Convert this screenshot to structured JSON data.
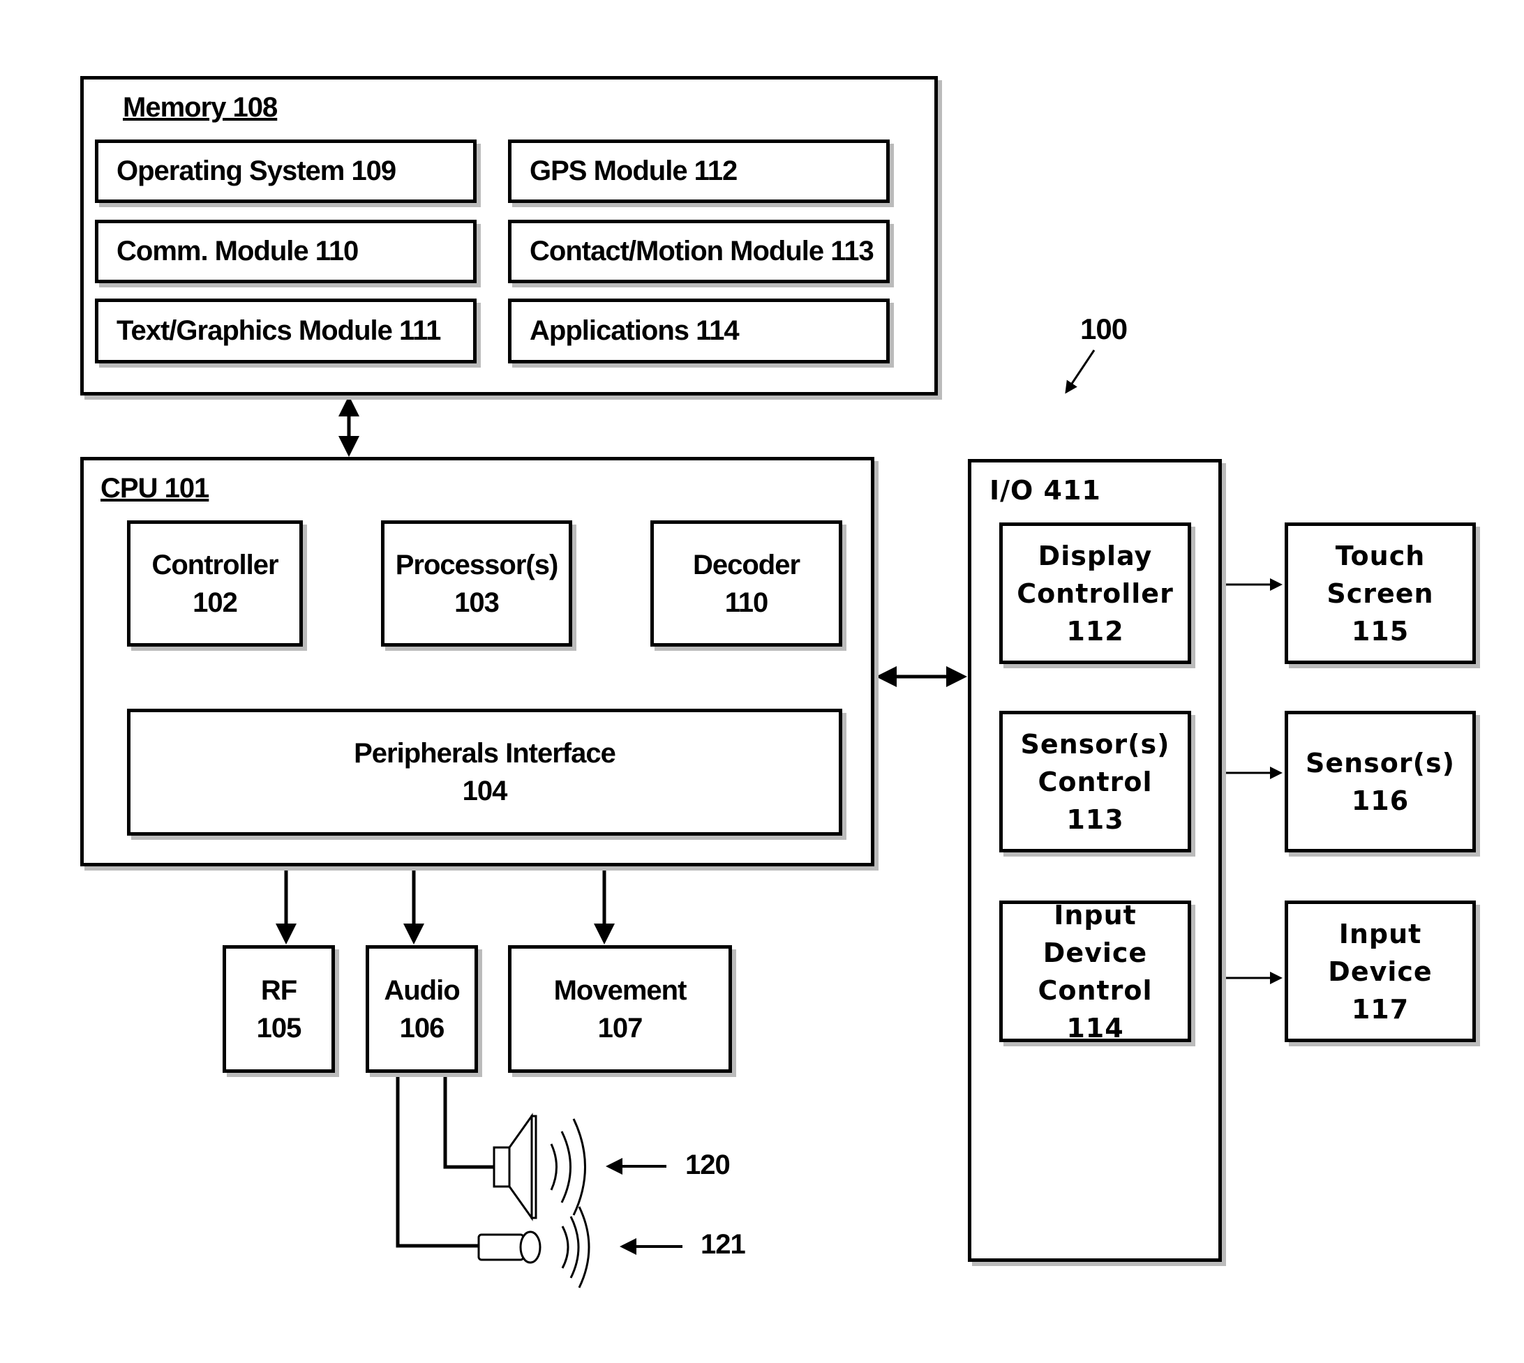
{
  "figure_ref": "100",
  "memory": {
    "title": "Memory 108",
    "modules": [
      "Operating System 109",
      "GPS Module 112",
      "Comm. Module 110",
      "Contact/Motion Module 113",
      "Text/Graphics Module 111",
      "Applications 114"
    ]
  },
  "cpu": {
    "title": "CPU 101",
    "controller": {
      "name": "Controller",
      "num": "102"
    },
    "processor": {
      "name": "Processor(s)",
      "num": "103"
    },
    "decoder": {
      "name": "Decoder",
      "num": "110"
    },
    "peripherals": {
      "name": "Peripherals Interface",
      "num": "104"
    }
  },
  "peripherals": {
    "rf": {
      "name": "RF",
      "num": "105"
    },
    "audio": {
      "name": "Audio",
      "num": "106"
    },
    "movement": {
      "name": "Movement",
      "num": "107"
    }
  },
  "audio_devices": {
    "speaker_ref": "120",
    "microphone_ref": "121"
  },
  "io": {
    "title": "I/O 411",
    "controllers": [
      {
        "line1": "Display",
        "line2": "Controller",
        "num": "112"
      },
      {
        "line1": "Sensor(s)",
        "line2": "Control",
        "num": "113"
      },
      {
        "line1": "Input Device",
        "line2": "Control",
        "num": "114"
      }
    ],
    "devices": [
      {
        "name": "Touch Screen",
        "num": "115"
      },
      {
        "name": "Sensor(s)",
        "num": "116"
      },
      {
        "name": "Input Device",
        "num": "117"
      }
    ]
  }
}
